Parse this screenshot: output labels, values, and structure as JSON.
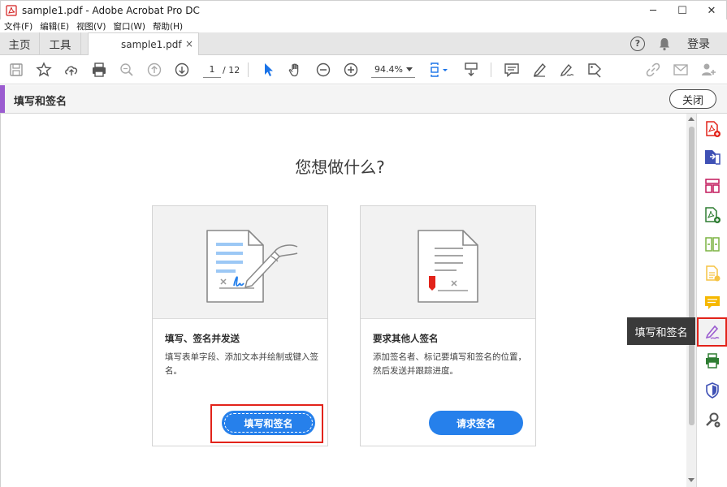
{
  "window": {
    "title": "sample1.pdf - Adobe Acrobat Pro DC",
    "controls": [
      "─",
      "☐",
      "✕"
    ]
  },
  "menu": [
    "文件(F)",
    "编辑(E)",
    "视图(V)",
    "窗口(W)",
    "帮助(H)"
  ],
  "tabs": {
    "home": "主页",
    "tools": "工具",
    "document": "sample1.pdf",
    "close": "×",
    "help": "?",
    "login": "登录"
  },
  "toolbar": {
    "page_current": "1",
    "page_total": "/ 12",
    "zoom": "94.4%"
  },
  "tool_header": {
    "label": "填写和签名",
    "close": "关闭",
    "accent_color": "#9b5cd0"
  },
  "main": {
    "heading": "您想做什么?",
    "cards": [
      {
        "title": "填写、签名并发送",
        "description": "填写表单字段、添加文本并绘制或键入签名。",
        "button": "填写和签名"
      },
      {
        "title": "要求其他人签名",
        "description": "添加签名者、标记要填写和签名的位置，然后发送并跟踪进度。",
        "button": "请求签名"
      }
    ]
  },
  "right_panel": {
    "tooltip": "填写和签名",
    "icons": [
      "create-pdf-icon",
      "export-pdf-icon",
      "organize-pages-icon",
      "combine-files-icon",
      "edit-pdf-icon",
      "enhance-scans-icon",
      "comment-icon",
      "fill-sign-icon",
      "print-production-icon",
      "protect-icon",
      "more-tools-icon"
    ]
  },
  "colors": {
    "primary_button": "#2680eb",
    "highlight_box": "#e2231a"
  }
}
